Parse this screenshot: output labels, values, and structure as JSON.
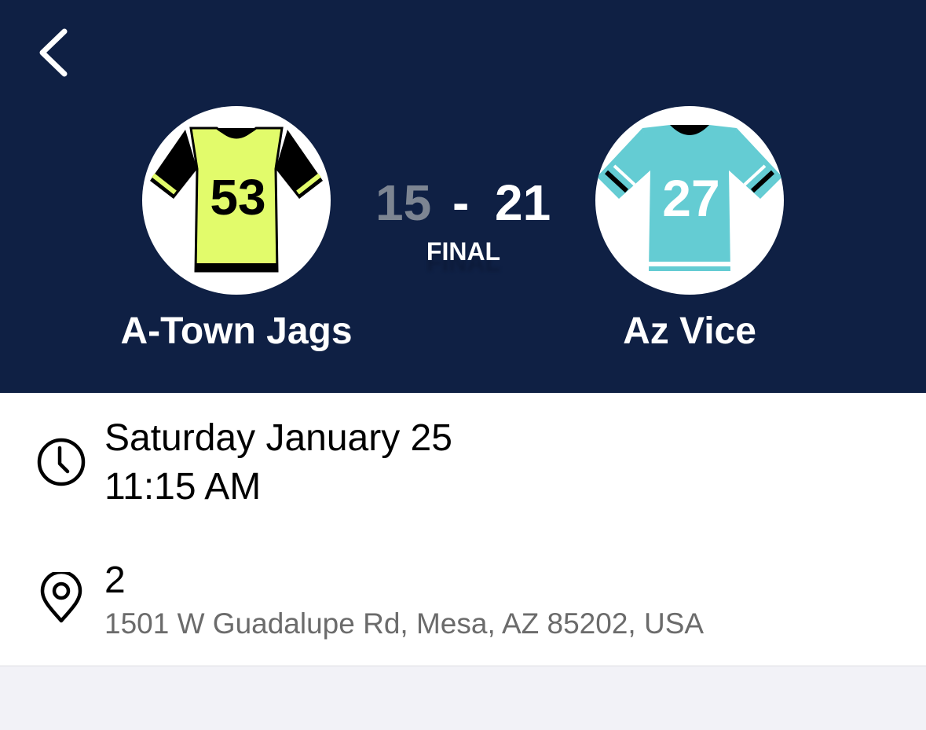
{
  "header": {
    "back_icon": "chevron-left-icon",
    "home_team": {
      "name": "A-Town Jags",
      "jersey_number": "53",
      "jersey_color": "#e2fb6b",
      "trim_color": "#000000"
    },
    "away_team": {
      "name": "Az Vice",
      "jersey_number": "27",
      "jersey_color": "#64ccd3",
      "trim_color": "#000000"
    },
    "score": {
      "home": "15",
      "separator": "-",
      "away": "21"
    },
    "status": "FINAL"
  },
  "details": {
    "clock_icon": "clock-icon",
    "date": "Saturday January 25",
    "time": "11:15 AM",
    "location_icon": "map-pin-icon",
    "field": "2",
    "address": "1501 W Guadalupe Rd, Mesa, AZ 85202, USA"
  },
  "colors": {
    "header_bg": "#0f2044",
    "page_bg": "#f2f2f7",
    "muted_score": "#7d8592"
  }
}
